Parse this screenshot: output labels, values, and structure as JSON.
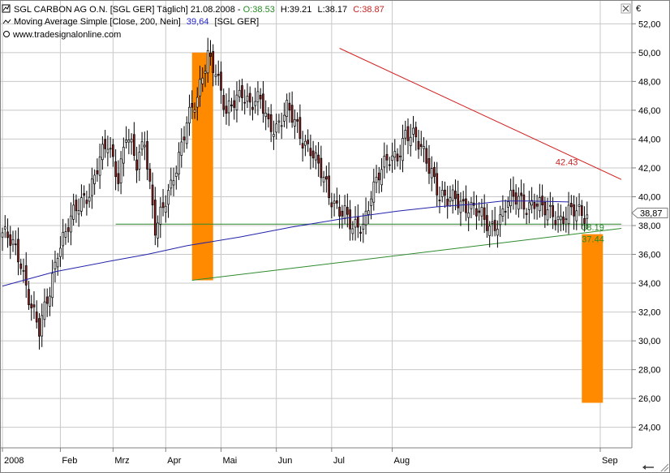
{
  "header": {
    "line1_title": "SGL CARBON AG O.N. [SGL GER] Täglich] 21.08.2008 -",
    "line1_o": "O:38.53",
    "line1_h": "H:39.21",
    "line1_l": "L:38.17",
    "line1_c": "C:38.87",
    "line2_label": "Moving Average Simple [Close, 200, Nein]",
    "line2_value": "39,64",
    "line2_suffix": "[SGL GER]",
    "line3_url": "www.tradesignalonline.com"
  },
  "colors": {
    "up_candle": "#ffffff",
    "down_candle": "#8b1a1a",
    "ma_line": "#2222aa",
    "resistance": "#d42020",
    "support": "#2d8a2d",
    "orange": "#ff8a00",
    "grid": "#c8c8c8",
    "green_text": "#228b22",
    "blue_text": "#2222cc",
    "red_text": "#cc2020"
  },
  "currency_symbol": "€",
  "chart_data": {
    "type": "line",
    "title": "SGL CARBON AG O.N. [SGL GER] Täglich",
    "ylim": [
      22.8,
      53.2
    ],
    "y_ticks": [
      "52,00",
      "50,00",
      "48,00",
      "46,00",
      "44,00",
      "42,00",
      "40,00",
      "38,00",
      "36,00",
      "34,00",
      "32,00",
      "30,00",
      "28,00",
      "26,00",
      "24,00"
    ],
    "x_labels": [
      "2008",
      "Feb",
      "Mrz",
      "Apr",
      "Mai",
      "Jun",
      "Jul",
      "Aug",
      "Sep"
    ],
    "last_price_label": "38,87",
    "series": [
      {
        "name": "SGL CARBON AG O.N.",
        "kind": "close",
        "x": [
          0,
          4,
          7,
          11,
          14,
          18,
          21,
          24,
          28,
          31,
          33,
          37,
          40,
          44,
          47,
          51,
          54,
          58,
          61,
          64,
          67,
          70,
          74,
          78,
          81,
          85,
          88,
          91,
          94,
          98,
          101,
          104,
          108,
          111,
          114,
          117,
          120,
          124,
          127,
          130,
          133,
          137,
          140,
          143,
          147,
          150,
          153,
          156,
          160,
          163,
          166,
          169,
          172,
          176,
          179,
          182,
          185,
          189,
          192,
          196,
          199,
          202,
          205,
          209,
          212,
          216,
          219,
          222
        ],
        "y": [
          37.5,
          36.5,
          35.5,
          32.5,
          30.5,
          33.5,
          36.5,
          37.5,
          39.0,
          40.0,
          40.5,
          42.5,
          43.5,
          41.5,
          44.5,
          42.0,
          44.0,
          38.0,
          39.0,
          40.5,
          43.0,
          45.5,
          46.5,
          50.0,
          49.0,
          45.5,
          46.5,
          47.5,
          46.5,
          46.5,
          45.0,
          45.0,
          46.0,
          45.0,
          44.0,
          43.5,
          42.0,
          40.0,
          39.5,
          39.0,
          37.5,
          38.0,
          40.5,
          41.5,
          42.5,
          43.0,
          44.5,
          44.0,
          43.0,
          42.0,
          40.0,
          39.5,
          40.0,
          39.5,
          39.0,
          38.5,
          38.0,
          38.5,
          39.5,
          40.0,
          39.5,
          39.5,
          39.0,
          39.0,
          38.5,
          38.8,
          38.9,
          38.87
        ]
      },
      {
        "name": "Moving Average Simple [Close, 200, Nein]",
        "kind": "ma",
        "x": [
          0,
          20,
          40,
          55,
          70,
          90,
          110,
          130,
          150,
          165,
          180,
          190,
          200,
          215
        ],
        "y": [
          33.8,
          34.8,
          35.5,
          36.0,
          36.6,
          37.2,
          37.9,
          38.5,
          39.0,
          39.3,
          39.5,
          39.7,
          39.7,
          39.64
        ]
      }
    ],
    "annotations": [
      {
        "text": "42.43",
        "color": "red"
      },
      {
        "text": "38.19",
        "color": "green"
      },
      {
        "text": "37.44",
        "color": "green"
      }
    ],
    "trendlines": [
      {
        "name": "resistance",
        "x": [
          128,
          235
        ],
        "y": [
          50.3,
          41.2
        ]
      },
      {
        "name": "support-rising",
        "x": [
          72,
          235
        ],
        "y": [
          34.2,
          37.8
        ]
      },
      {
        "name": "support-horizontal",
        "x": [
          43,
          235
        ],
        "y": [
          38.1,
          38.1
        ]
      }
    ],
    "range_bars": [
      {
        "name": "left-range",
        "x0": 72,
        "x1": 80,
        "y_low": 34.2,
        "y_high": 50.0
      },
      {
        "name": "target-range",
        "x0": 220,
        "x1": 228,
        "y_low": 25.7,
        "y_high": 37.4
      }
    ],
    "grid": true,
    "x_day_range": [
      0,
      235
    ]
  }
}
